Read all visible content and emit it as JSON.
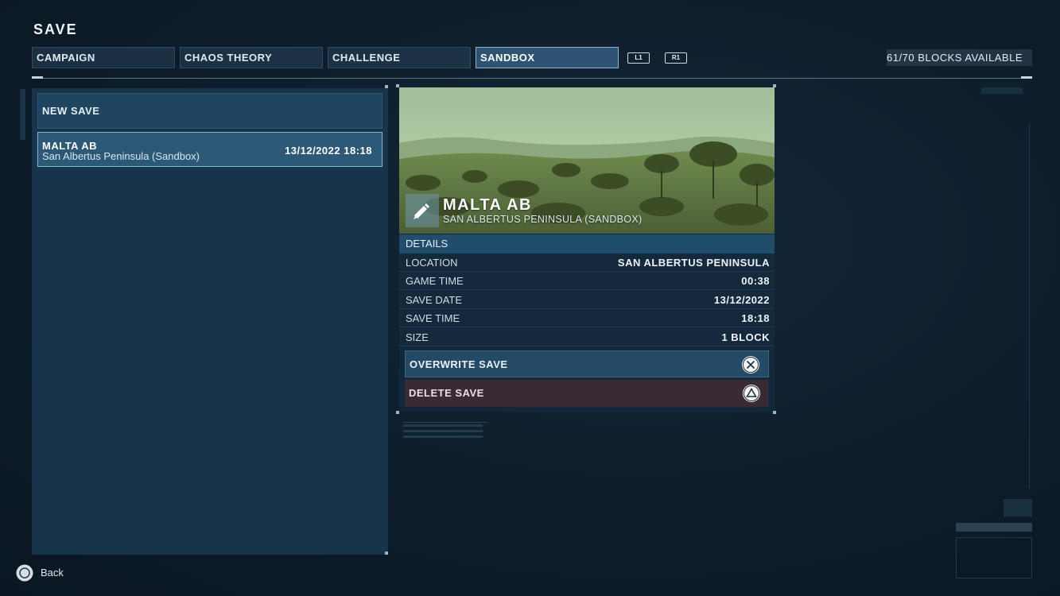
{
  "header": {
    "title": "SAVE",
    "tabs": [
      {
        "label": "CAMPAIGN",
        "active": false
      },
      {
        "label": "CHAOS THEORY",
        "active": false
      },
      {
        "label": "CHALLENGE",
        "active": false
      },
      {
        "label": "SANDBOX",
        "active": true
      }
    ],
    "shoulder_left": "L1",
    "shoulder_right": "R1",
    "blocks_available": "61/70 BLOCKS AVAILABLE"
  },
  "save_list": {
    "new_save_label": "NEW SAVE",
    "slots": [
      {
        "name": "MALTA AB",
        "location": "San Albertus Peninsula (Sandbox)",
        "datetime": "13/12/2022 18:18"
      }
    ]
  },
  "details": {
    "preview_name": "MALTA AB",
    "preview_subtitle": "SAN ALBERTUS PENINSULA (SANDBOX)",
    "preview_icon": "sandbox-pen-icon",
    "header": "DETAILS",
    "rows": [
      {
        "key": "LOCATION",
        "value": "SAN ALBERTUS PENINSULA"
      },
      {
        "key": "GAME TIME",
        "value": "00:38"
      },
      {
        "key": "SAVE DATE",
        "value": "13/12/2022"
      },
      {
        "key": "SAVE TIME",
        "value": "18:18"
      },
      {
        "key": "SIZE",
        "value": "1 BLOCK"
      }
    ],
    "actions": {
      "overwrite_label": "OVERWRITE SAVE",
      "overwrite_icon": "cross-button-icon",
      "delete_label": "DELETE SAVE",
      "delete_icon": "triangle-button-icon"
    }
  },
  "footer": {
    "back_label": "Back",
    "back_icon": "circle-button-icon"
  },
  "colors": {
    "background": "#0e1d2b",
    "accent": "#2d5272",
    "active_border": "#8fb2cc",
    "delete_bg": "#3a2a36"
  }
}
